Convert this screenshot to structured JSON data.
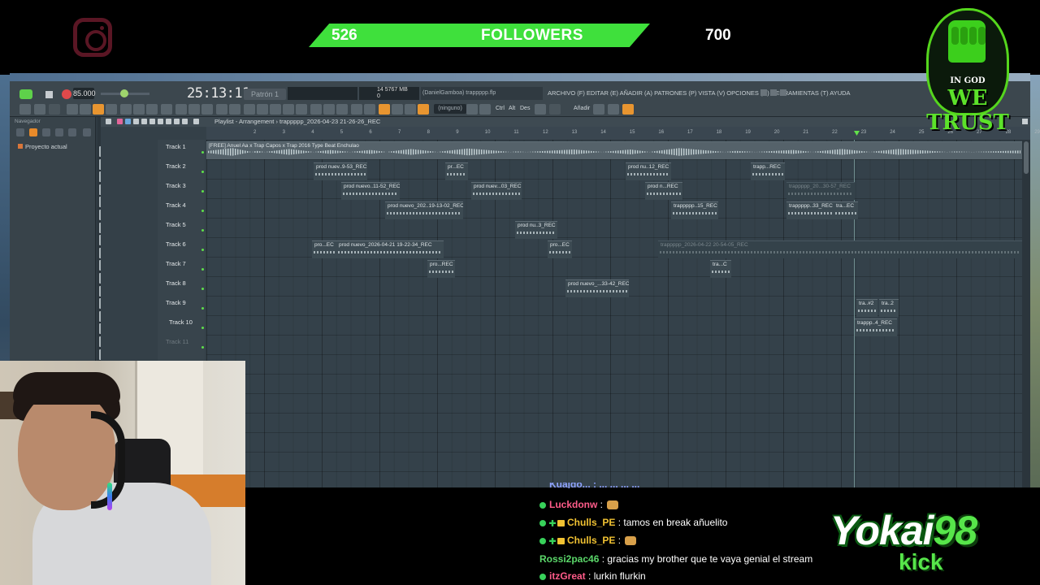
{
  "overlay": {
    "followers_current": "526",
    "followers_label": "FOLLOWERS",
    "followers_goal": "700",
    "logo_top": "IN GOD",
    "logo_bottom": "WE TRUST",
    "brand_name_a": "Yokai",
    "brand_name_b": "98",
    "brand_sub": "kick",
    "bar_color": "#3fe03c",
    "progress_fraction": 0.75
  },
  "fl": {
    "tempo": "85.000",
    "time": "25:13:11",
    "pattern": "Patrón 1",
    "memory": "5767 MB",
    "memory_small": "14",
    "memory_zero": "0",
    "project_hint": "(DanielGamboa)  trappppp.flp",
    "menu": "ARCHIVO (F)  EDITAR (E)  AÑADIR (A)  PATRONES (P)  VISTA (V)  OPCIONES (O)  HERRAMIENTAS (T)  AYUDA",
    "toolbar_select": "(ninguno)",
    "toolbar_ctrl": "Ctrl",
    "toolbar_alt": "Alt",
    "toolbar_des": "Des",
    "toolbar_add": "Añadir",
    "browser_title": "Navegador",
    "browser_folder": "Proyecto actual",
    "playlist_title": "Playlist - Arrangement › trappppp_2026-04-23 21-26-26_REC",
    "channel_label": "trappppp_2026-04-",
    "tracks": [
      "Track 1",
      "Track 2",
      "Track 3",
      "Track 4",
      "Track 5",
      "Track 6",
      "Track 7",
      "Track 8",
      "Track 9",
      "Track 10",
      "Track 11"
    ],
    "bars": [
      "2",
      "3",
      "4",
      "5",
      "6",
      "7",
      "8",
      "9",
      "10",
      "11",
      "12",
      "13",
      "14",
      "15",
      "16",
      "17",
      "18",
      "19",
      "20",
      "21",
      "22",
      "23",
      "24",
      "25",
      "26",
      "27",
      "28",
      "29",
      "30",
      "31"
    ],
    "clips": [
      {
        "label": "[FREE] Anuel Aa x Trap Capos x Trap 2016 Type Beat Enchulao"
      },
      {
        "label": "prod nuev..9-53_REC"
      },
      {
        "label": "pr...EC"
      },
      {
        "label": "prod nu..12_REC"
      },
      {
        "label": "trapp...REC"
      },
      {
        "label": "prod nuevo..11-52_REC"
      },
      {
        "label": "prod nuev...03_REC"
      },
      {
        "label": "prod n...REC"
      },
      {
        "label": "trappppp_20...30-57_REC"
      },
      {
        "label": "prod nuevo_202..19-13-02_REC"
      },
      {
        "label": "trappppp..15_REC"
      },
      {
        "label": "trappppp..33_REC"
      },
      {
        "label": "tra...EC"
      },
      {
        "label": "prod nu..3_REC"
      },
      {
        "label": "pro...EC"
      },
      {
        "label": "prod nuevo_2026-04-21 19-22-34_REC"
      },
      {
        "label": "pro...EC"
      },
      {
        "label": "trappppp_2026-04-22 20-54-05_REC"
      },
      {
        "label": "pro...REC"
      },
      {
        "label": "tra...C"
      },
      {
        "label": "prod nuevo_...33-42_REC"
      },
      {
        "label": "tra..#2"
      },
      {
        "label": "tra..2"
      },
      {
        "label": "trappp..4_REC"
      }
    ]
  },
  "chat": {
    "cut_line": "Kuajdo... : ... ... ... ...",
    "messages": [
      {
        "user": "Luckdonw",
        "color": "#ff5c8a",
        "text": ""
      },
      {
        "user": "Chulls_PE",
        "color": "#f1c232",
        "text": "tamos en break añuelito"
      },
      {
        "user": "Chulls_PE",
        "color": "#f1c232",
        "text": ""
      },
      {
        "user": "Rossi2pac46",
        "color": "#5bd86a",
        "text": "gracias my brother que te vaya genial el stream"
      },
      {
        "user": "itzGreat",
        "color": "#ff5c8a",
        "text": "lurkin flurkin"
      }
    ]
  }
}
